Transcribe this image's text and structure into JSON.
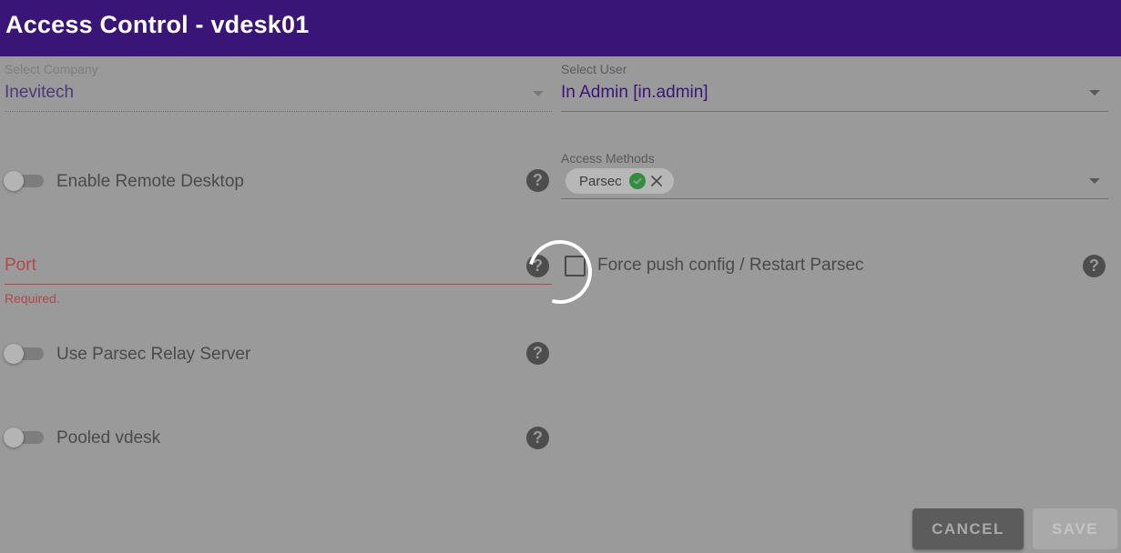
{
  "window": {
    "title": "Access Control - vdesk01"
  },
  "company": {
    "label": "Select Company",
    "value": "Inevitech"
  },
  "user": {
    "label": "Select User",
    "value": "In Admin [in.admin]"
  },
  "access_methods": {
    "label": "Access Methods",
    "chips": [
      {
        "label": "Parsec"
      }
    ]
  },
  "toggles": {
    "remote_desktop": {
      "label": "Enable Remote Desktop"
    },
    "relay_server": {
      "label": "Use Parsec Relay Server"
    },
    "pooled": {
      "label": "Pooled vdesk"
    }
  },
  "port": {
    "label": "Port",
    "error": "Required."
  },
  "force_push": {
    "label": "Force push config / Restart Parsec"
  },
  "help": {
    "glyph": "?"
  },
  "buttons": {
    "cancel": "CANCEL",
    "save": "SAVE"
  },
  "colors": {
    "header": "#3a1578",
    "overlay": "#9a9a9a",
    "error": "#b44848",
    "chip_check": "#2f8f3d"
  },
  "icons": [
    "caret-down-icon",
    "help-icon",
    "check-circle-icon",
    "close-icon",
    "loading-spinner"
  ]
}
